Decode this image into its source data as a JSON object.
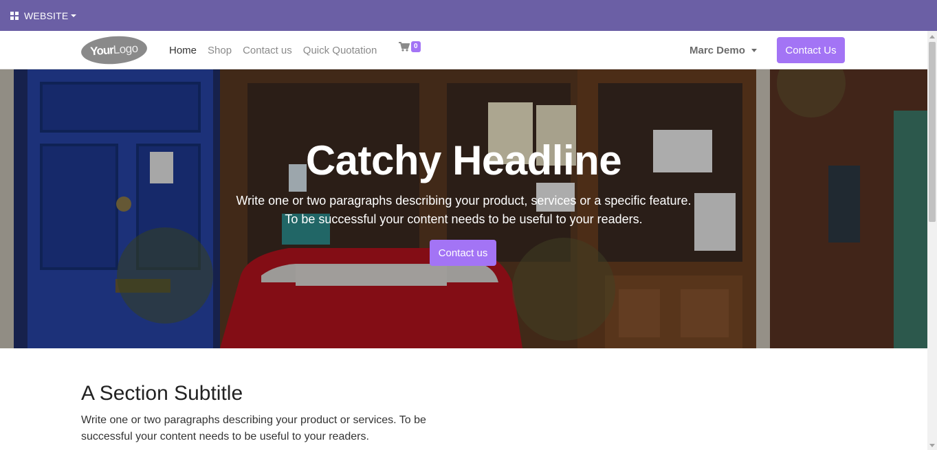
{
  "adminbar": {
    "menu_label": "WEBSITE",
    "menu_icon": "grid-icon",
    "background": "#6b5fa5"
  },
  "navbar": {
    "logo": {
      "text_bold": "Your",
      "text_light": "Logo"
    },
    "links": [
      {
        "label": "Home",
        "active": true
      },
      {
        "label": "Shop",
        "active": false
      },
      {
        "label": "Contact us",
        "active": false
      },
      {
        "label": "Quick Quotation",
        "active": false
      }
    ],
    "cart": {
      "icon": "cart-icon",
      "count": "0"
    },
    "user": {
      "name": "Marc Demo"
    },
    "cta_label": "Contact Us",
    "accent": "#a374f5"
  },
  "hero": {
    "title": "Catchy Headline",
    "text_line1": "Write one or two paragraphs describing your product, services or a specific feature.",
    "text_line2": "To be successful your content needs to be useful to your readers.",
    "button_label": "Contact us"
  },
  "section": {
    "subtitle": "A Section Subtitle",
    "text": "Write one or two paragraphs describing your product or services. To be successful your content needs to be useful to your readers."
  }
}
